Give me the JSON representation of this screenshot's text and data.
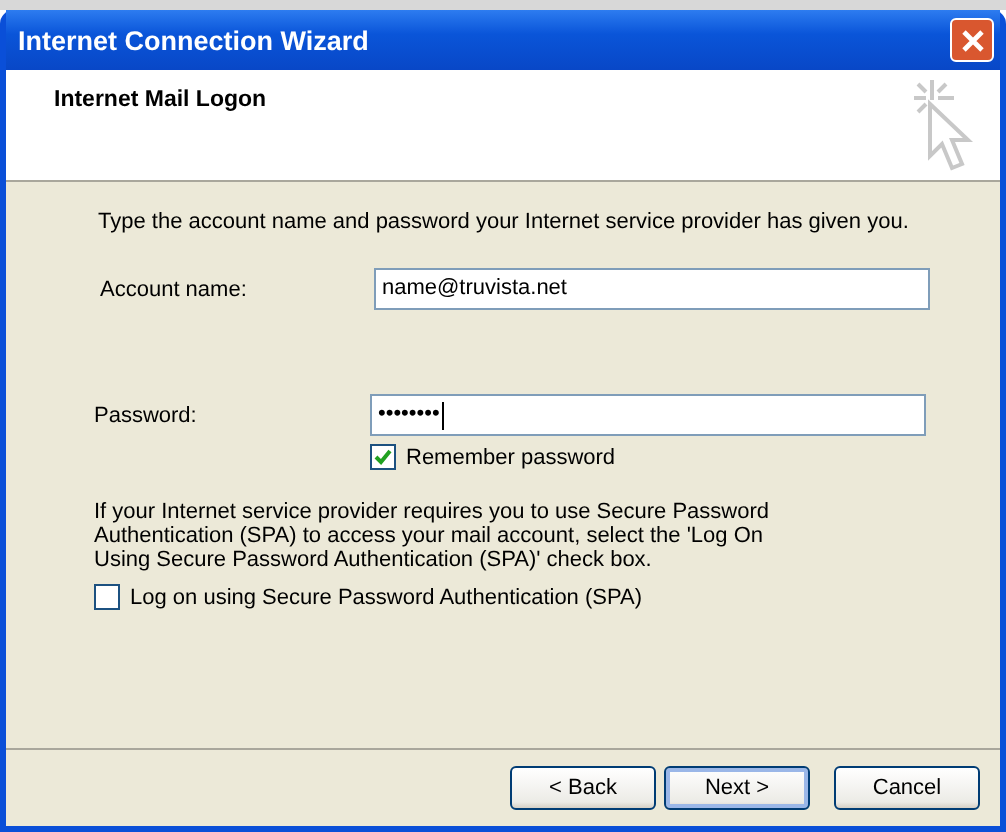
{
  "window": {
    "title": "Internet Connection Wizard"
  },
  "header": {
    "title": "Internet Mail Logon"
  },
  "intro": "Type the account name and password your Internet service provider has given you.",
  "fields": [
    {
      "label": "Account name:",
      "value": "name@truvista.net",
      "focused": false
    },
    {
      "label": "Password:",
      "value": "••••••••",
      "focused": true
    }
  ],
  "remember_password": {
    "label": "Remember password",
    "checked": true
  },
  "spa_note": "If your Internet service provider requires you to use Secure Password Authentication (SPA) to access your mail account, select the 'Log On Using Secure Password Authentication (SPA)' check box.",
  "spa": {
    "label": "Log on using Secure Password Authentication (SPA)",
    "checked": false
  },
  "buttons": [
    {
      "label": "< Back",
      "default": false
    },
    {
      "label": "Next >",
      "default": true
    },
    {
      "label": "Cancel",
      "default": false
    }
  ]
}
